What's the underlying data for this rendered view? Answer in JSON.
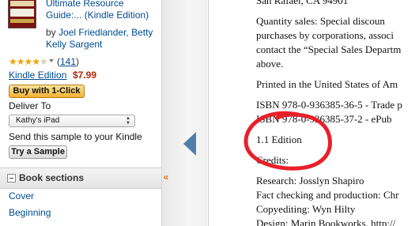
{
  "book": {
    "title_line1": "Ultimate Resource",
    "title_line2": "Guide:... (Kindle Edition)",
    "author_prefix": "by ",
    "author1": "Joel Friedlander,",
    "author2_line1": "Betty",
    "author2_line2": "Kelly Sargent",
    "rating_stars": 4,
    "review_count_open": "(",
    "review_count": "141",
    "review_count_close": ")",
    "format_label": "Kindle Edition",
    "price": "$7.99"
  },
  "purchase": {
    "buy_button_label": "Buy with 1-Click",
    "deliver_to_label": "Deliver To",
    "device_selected": "Kathy's iPad",
    "sample_text": "Send this sample to your Kindle",
    "sample_button_label": "Try a Sample"
  },
  "sections": {
    "header": "Book sections",
    "items": [
      "Cover",
      "Beginning"
    ]
  },
  "page_lines": [
    "San Rafael, CA 94901",
    "Quantity sales: Special discoun",
    "purchases by corporations, associ",
    "contact the “Special Sales Departm",
    "above.",
    "Printed in the United States of Am",
    "ISBN 978-0-936385-36-5 - Trade p",
    "ISBN 978-0-936385-37-2 - ePub",
    "1.1 Edition",
    "Credits:",
    "Research: Josslyn Shapiro",
    "Fact checking and production: Chr",
    "Copyediting: Wyn Hilty",
    "Design: Marin Bookworks, http://"
  ],
  "colors": {
    "link": "#004b91",
    "price": "#b12704",
    "annotation": "#e8202a",
    "nav_arrow": "#4f7ea8"
  },
  "icons": {
    "prev_page": "left-triangle",
    "collapse": "double-chevron-left"
  }
}
